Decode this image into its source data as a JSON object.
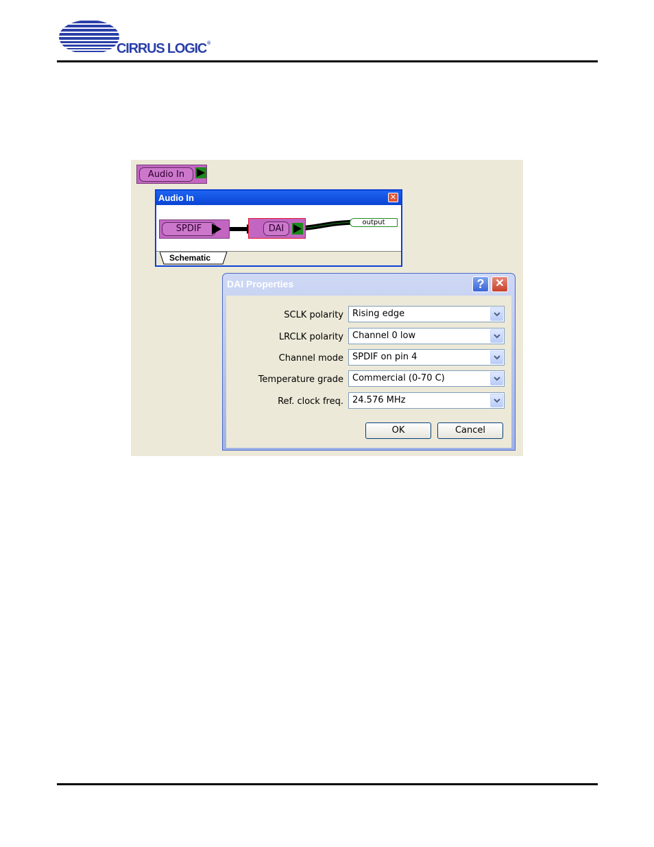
{
  "header": {
    "logo_text": "CIRRUS LOGIC",
    "logo_reg": "®"
  },
  "block": {
    "label": "Audio In"
  },
  "subwindow": {
    "title": "Audio In",
    "close_symbol": "✕",
    "blocks": [
      {
        "label": "SPDIF"
      },
      {
        "label": "DAI"
      }
    ],
    "output_label": "output",
    "tab_label": "Schematic"
  },
  "dialog": {
    "title": "DAI Properties",
    "help_symbol": "?",
    "close_symbol": "✕",
    "fields": [
      {
        "label": "SCLK polarity",
        "value": "Rising edge"
      },
      {
        "label": "LRCLK polarity",
        "value": "Channel 0 low"
      },
      {
        "label": "Channel mode",
        "value": "SPDIF on pin 4"
      },
      {
        "label": "Temperature grade",
        "value": "Commercial (0-70 C)"
      },
      {
        "label": "Ref. clock freq.",
        "value": "24.576 MHz"
      }
    ],
    "ok_label": "OK",
    "cancel_label": "Cancel"
  },
  "colors": {
    "block_fill": "#c266c2",
    "titlebar_blue": "#0a44d4",
    "selected_border": "#e0142b",
    "logo_blue": "#2a3fa8"
  },
  "icons": {
    "logo": "cirrus-logic-logo-icon",
    "port": "port-arrow-icon",
    "dropdown": "chevron-down-icon",
    "help": "help-icon",
    "close": "close-icon"
  }
}
